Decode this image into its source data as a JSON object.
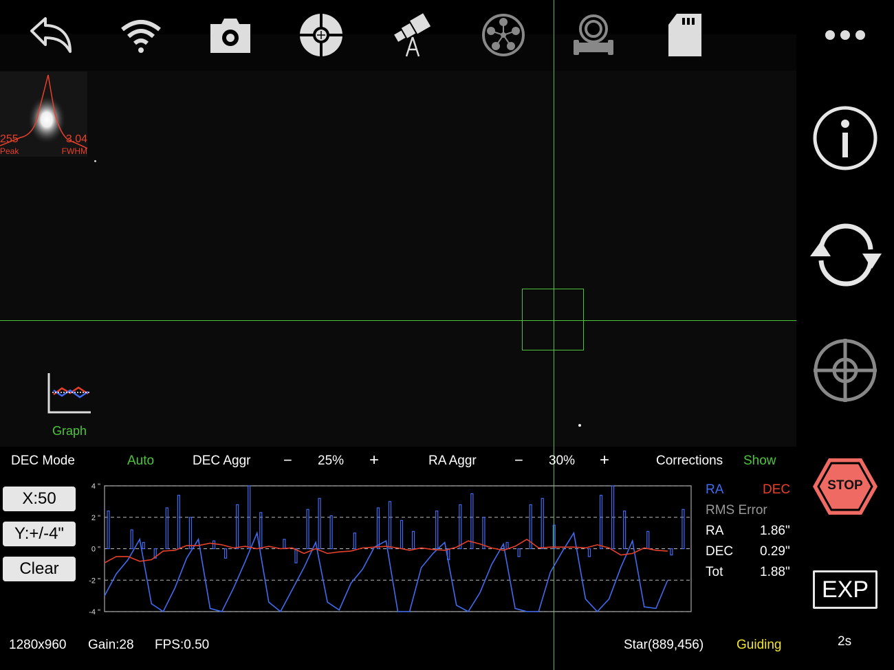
{
  "toolbar": {
    "icons": [
      "back-icon",
      "wifi-icon",
      "camera-icon",
      "guide-target-icon",
      "telescope-icon",
      "filter-wheel-icon",
      "focuser-icon",
      "sd-card-icon",
      "more-icon"
    ]
  },
  "star_profile": {
    "peak_value": "255",
    "peak_label": "Peak",
    "fwhm_value": "3.04",
    "fwhm_label": "FWHM"
  },
  "graph_button": {
    "label": "Graph"
  },
  "controls": {
    "dec_mode_label": "DEC Mode",
    "dec_mode_value": "Auto",
    "dec_aggr_label": "DEC Aggr",
    "dec_aggr_minus": "−",
    "dec_aggr_value": "25%",
    "dec_aggr_plus": "+",
    "ra_aggr_label": "RA Aggr",
    "ra_aggr_minus": "−",
    "ra_aggr_value": "30%",
    "ra_aggr_plus": "+",
    "corrections_label": "Corrections",
    "corrections_value": "Show"
  },
  "graph_buttons": {
    "x_scale": "X:50",
    "y_scale": "Y:+/-4\"",
    "clear": "Clear"
  },
  "chart_data": {
    "type": "line",
    "y_ticks": [
      "4 \"",
      "2 \"",
      "0 \"",
      "-2 \"",
      "-4 \""
    ],
    "ylim": [
      -4,
      4
    ],
    "xlim": [
      0,
      50
    ],
    "grid": true,
    "colors": {
      "ra": "#3f6cf0",
      "dec": "#e8402a"
    },
    "series": [
      {
        "name": "RA",
        "values": [
          -3.0,
          -1.6,
          -0.7,
          0.6,
          -3.5,
          -4.0,
          -2.5,
          -0.6,
          0.6,
          -3.8,
          -4.0,
          -2.5,
          -0.8,
          1.0,
          -3.4,
          -4.0,
          -2.6,
          -1.2,
          0.4,
          -3.4,
          -3.9,
          -2.2,
          -1.3,
          0.1,
          0.5,
          -4.0,
          -4.0,
          -1.2,
          -0.3,
          0.4,
          -3.6,
          -4.0,
          -2.8,
          -1.0,
          0.3,
          -3.8,
          -4.0,
          -4.0,
          -1.5,
          -0.2,
          1.0,
          -3.2,
          -4.0,
          -3.2,
          -1.2,
          0.5,
          -3.7,
          -3.8,
          -2.0
        ]
      },
      {
        "name": "DEC",
        "values": [
          -0.9,
          -0.5,
          -0.5,
          -0.8,
          -0.7,
          -0.15,
          -0.1,
          0.2,
          0.2,
          0.35,
          0.25,
          0.05,
          0.15,
          0,
          0.15,
          0,
          0.05,
          -0.3,
          0,
          -0.3,
          -0.2,
          -0.15,
          0.05,
          0.1,
          0.15,
          0.05,
          -0.1,
          0.05,
          -0.05,
          -0.1,
          0.1,
          0.5,
          0.3,
          0.05,
          -0.1,
          0.15,
          0.6,
          0.05,
          0.1,
          0.1,
          0.1,
          0.05,
          0.25,
          0.05,
          -0.4,
          -0.3,
          0.05,
          -0.1,
          -0.15
        ]
      },
      {
        "name": "RA corrections",
        "type": "bar",
        "values": [
          2.4,
          0,
          1.2,
          0.4,
          -0.6,
          2.6,
          3.4,
          2.0,
          0,
          0.5,
          -0.6,
          2.8,
          4.0,
          2.3,
          0,
          0.6,
          -0.9,
          2.5,
          3.2,
          2.1,
          0,
          1.0,
          0,
          2.6,
          3.0,
          1.8,
          1.1,
          0,
          2.4,
          -0.7,
          2.8,
          3.5,
          2.0,
          0,
          0.4,
          -0.5,
          2.8,
          3.2,
          1.5,
          0,
          0,
          -0.5,
          3.4,
          4.0,
          2.4,
          0,
          1.1,
          0,
          -0.4,
          2.5
        ]
      }
    ]
  },
  "legend": {
    "ra": "RA",
    "dec": "DEC"
  },
  "rms": {
    "title": "RMS Error",
    "rows": [
      {
        "label": "RA",
        "value": "1.86\""
      },
      {
        "label": "DEC",
        "value": "0.29\""
      },
      {
        "label": "Tot",
        "value": "1.88\""
      }
    ]
  },
  "side": {
    "stop_label": "STOP",
    "exp_label": "EXP",
    "exposure": "2s"
  },
  "status": {
    "resolution": "1280x960",
    "gain": "Gain:28",
    "fps": "FPS:0.50",
    "star": "Star(889,456)",
    "state": "Guiding"
  },
  "colors": {
    "crosshair": "#4cc53a",
    "accent_green": "#4cc53a",
    "guiding": "#f2e52c",
    "stop": "#ee6a62"
  }
}
